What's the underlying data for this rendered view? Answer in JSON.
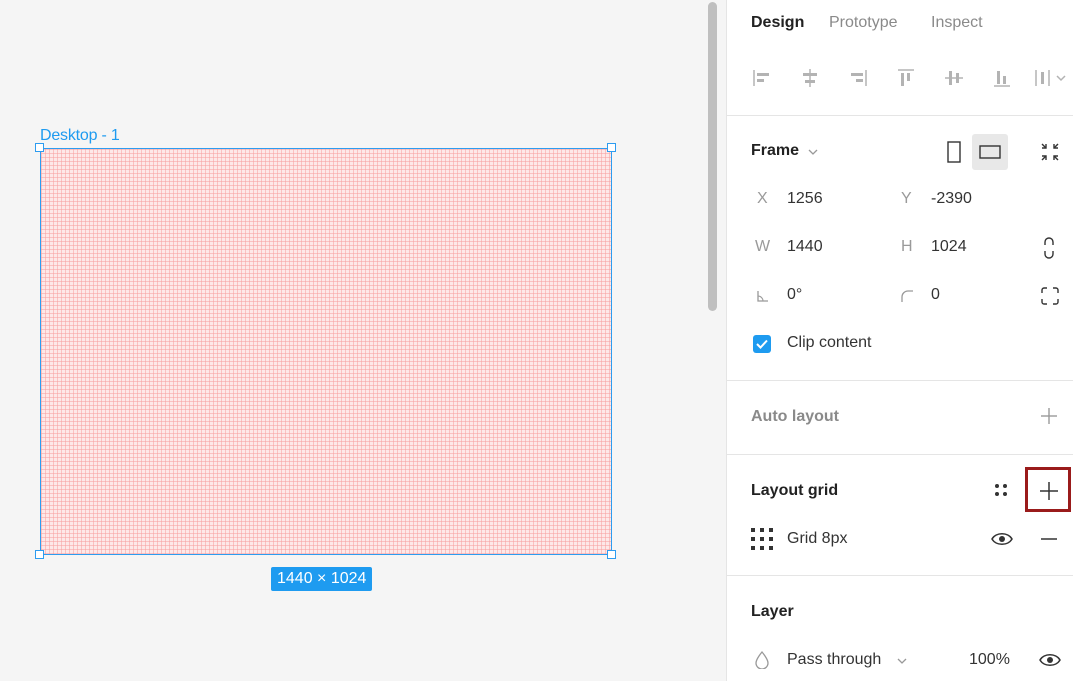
{
  "canvas": {
    "frame_label": "Desktop - 1",
    "size_badge": "1440 × 1024",
    "grid_color": "#f8a0a0",
    "selection_color": "#1e9bf0"
  },
  "panel": {
    "tabs": [
      {
        "label": "Design",
        "active": true
      },
      {
        "label": "Prototype",
        "active": false
      },
      {
        "label": "Inspect",
        "active": false
      }
    ],
    "alignment_icons": [
      "align-left-icon",
      "align-horizontal-center-icon",
      "align-right-icon",
      "align-top-icon",
      "align-vertical-center-icon",
      "align-bottom-icon",
      "distribute-icon"
    ],
    "frame": {
      "title": "Frame",
      "x_label": "X",
      "x_value": "1256",
      "y_label": "Y",
      "y_value": "-2390",
      "w_label": "W",
      "w_value": "1440",
      "h_label": "H",
      "h_value": "1024",
      "rotation_value": "0°",
      "radius_value": "0",
      "clip_label": "Clip content",
      "clip_checked": true
    },
    "auto_layout": {
      "title": "Auto layout"
    },
    "layout_grid": {
      "title": "Layout grid",
      "grids": [
        {
          "label": "Grid 8px",
          "visible": true
        }
      ]
    },
    "layer": {
      "title": "Layer",
      "blend_mode": "Pass through",
      "opacity": "100%"
    }
  }
}
